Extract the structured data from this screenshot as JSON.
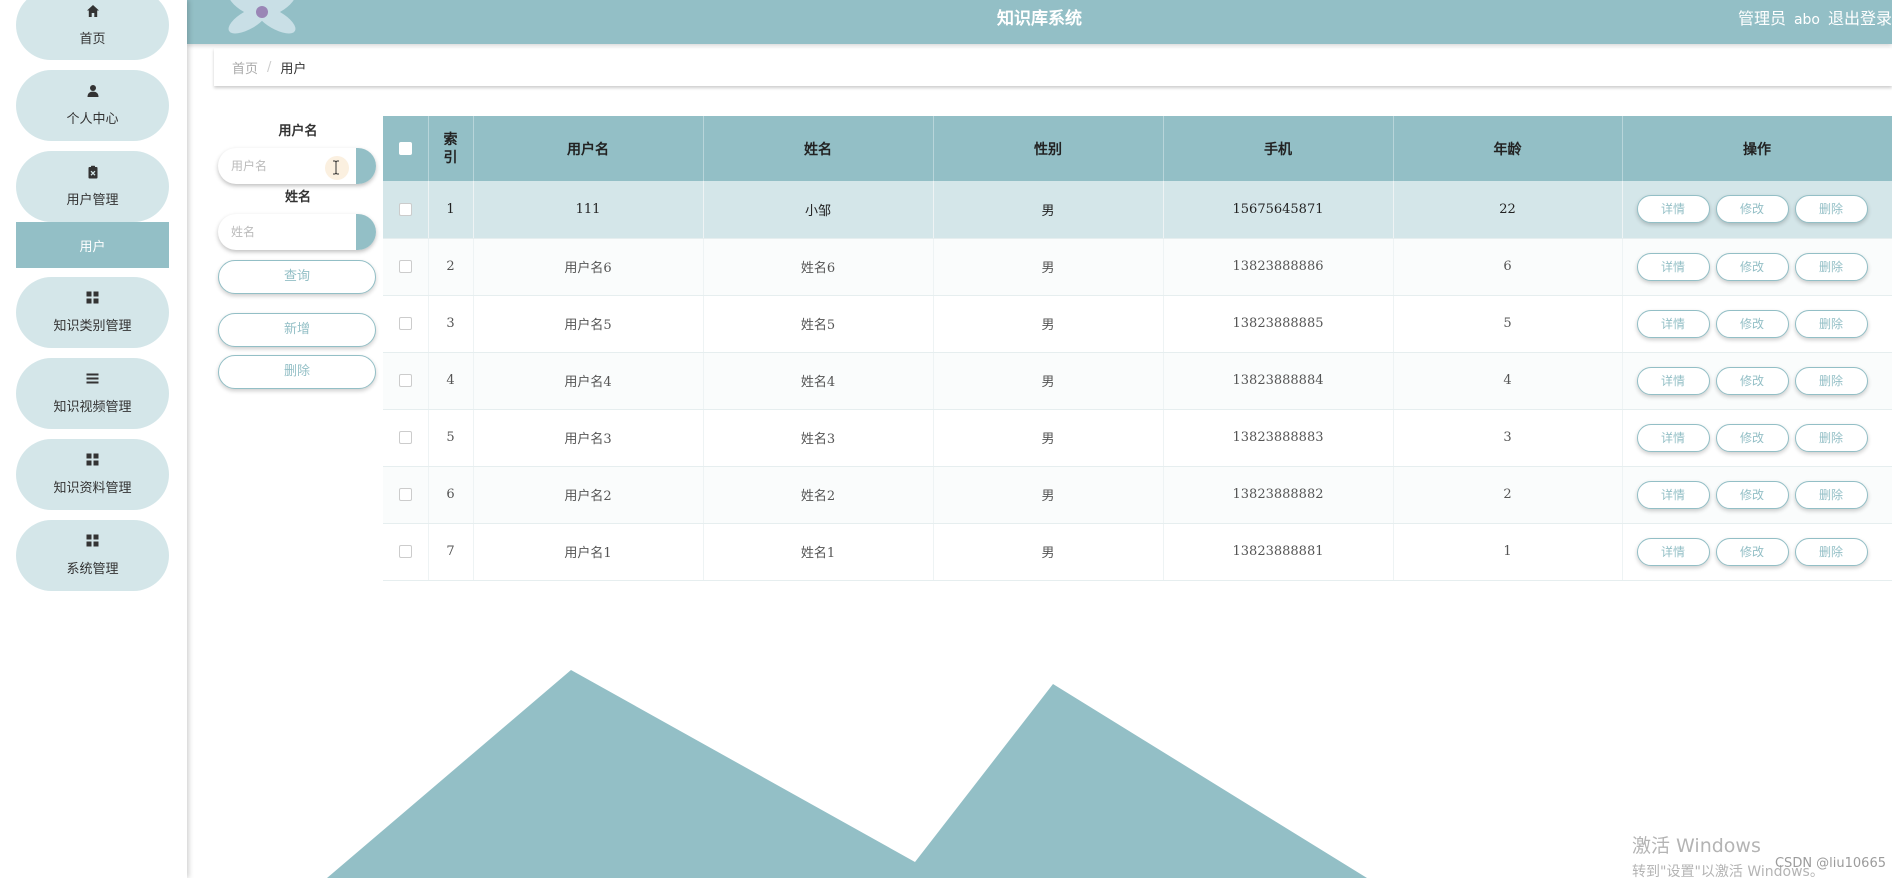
{
  "header": {
    "title": "知识库系统",
    "role": "管理员",
    "username": "abo",
    "logout": "退出登录"
  },
  "sidebar": {
    "items": [
      {
        "label": "首页",
        "icon": "home-icon"
      },
      {
        "label": "个人中心",
        "icon": "person-icon"
      },
      {
        "label": "用户管理",
        "icon": "clipboard-icon"
      },
      {
        "label": "知识类别管理",
        "icon": "grid-icon"
      },
      {
        "label": "知识视频管理",
        "icon": "list-icon"
      },
      {
        "label": "知识资料管理",
        "icon": "grid-icon"
      },
      {
        "label": "系统管理",
        "icon": "grid-icon"
      }
    ],
    "active_submenu": "用户"
  },
  "breadcrumb": {
    "home": "首页",
    "separator": "/",
    "current": "用户"
  },
  "search": {
    "username_label": "用户名",
    "username_placeholder": "用户名",
    "name_label": "姓名",
    "name_placeholder": "姓名",
    "query_button": "查询",
    "add_button": "新增",
    "delete_button": "删除"
  },
  "table": {
    "columns": [
      "索引",
      "用户名",
      "姓名",
      "性别",
      "手机",
      "年龄",
      "操作"
    ],
    "rows": [
      {
        "index": "1",
        "username": "111",
        "name": "小邹",
        "gender": "男",
        "phone": "15675645871",
        "age": "22"
      },
      {
        "index": "2",
        "username": "用户名6",
        "name": "姓名6",
        "gender": "男",
        "phone": "13823888886",
        "age": "6"
      },
      {
        "index": "3",
        "username": "用户名5",
        "name": "姓名5",
        "gender": "男",
        "phone": "13823888885",
        "age": "5"
      },
      {
        "index": "4",
        "username": "用户名4",
        "name": "姓名4",
        "gender": "男",
        "phone": "13823888884",
        "age": "4"
      },
      {
        "index": "5",
        "username": "用户名3",
        "name": "姓名3",
        "gender": "男",
        "phone": "13823888883",
        "age": "3"
      },
      {
        "index": "6",
        "username": "用户名2",
        "name": "姓名2",
        "gender": "男",
        "phone": "13823888882",
        "age": "2"
      },
      {
        "index": "7",
        "username": "用户名1",
        "name": "姓名1",
        "gender": "男",
        "phone": "13823888881",
        "age": "1"
      }
    ],
    "actions": {
      "detail": "详情",
      "edit": "修改",
      "delete": "删除"
    }
  },
  "watermark": {
    "title": "激活 Windows",
    "subtitle": "转到\"设置\"以激活 Windows。",
    "credit": "CSDN @liu10665"
  },
  "colors": {
    "accent": "#93bfc6",
    "pill": "#d4e6e9",
    "highlight_row": "#d4e6e9"
  }
}
